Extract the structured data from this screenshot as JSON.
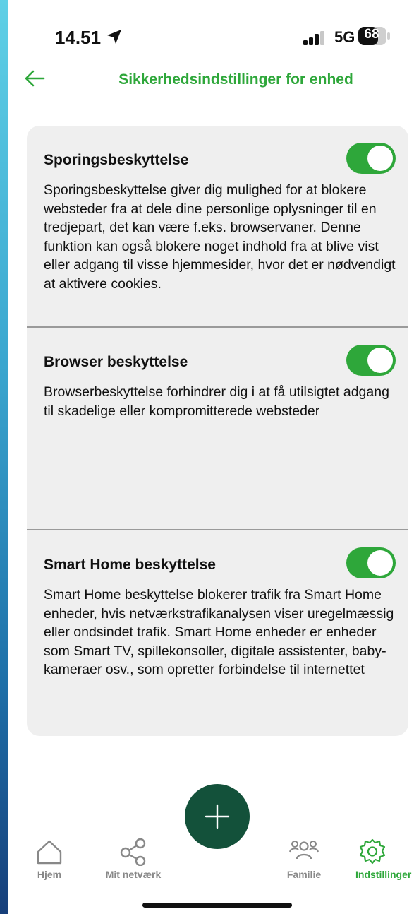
{
  "status_bar": {
    "time": "14.51",
    "network": "5G",
    "battery": "68"
  },
  "header": {
    "title": "Sikkerhedsindstillinger for enhed"
  },
  "settings": [
    {
      "title": "Sporingsbeskyttelse",
      "enabled": true,
      "description": "Sporingsbeskyttelse giver dig mulighed for at blokere websteder fra at dele dine personlige oplysninger til en tredjepart, det kan være f.eks. browservaner. Denne funktion kan også blokere noget indhold fra at blive vist eller adgang til visse hjemmesider, hvor det er nødvendigt at aktivere cookies."
    },
    {
      "title": "Browser beskyttelse",
      "enabled": true,
      "description": "Browserbeskyttelse forhindrer dig i at få utilsigtet adgang til skadelige eller kompromitterede websteder"
    },
    {
      "title": "Smart Home beskyttelse",
      "enabled": true,
      "description": "Smart Home beskyttelse blokerer trafik fra Smart Home enheder, hvis netværkstrafikanalysen viser uregelmæssig eller ondsindet trafik. Smart Home enheder er enheder som Smart TV, spillekonsoller, digitale assistenter, baby-kameraer osv., som opretter forbindelse til internettet"
    }
  ],
  "nav": {
    "items": [
      {
        "label": "Hjem",
        "icon": "home-icon",
        "active": false
      },
      {
        "label": "Mit netværk",
        "icon": "share-network-icon",
        "active": false
      },
      {
        "label": "Familie",
        "icon": "family-icon",
        "active": false
      },
      {
        "label": "Indstillinger",
        "icon": "gear-icon",
        "active": true
      }
    ],
    "fab_icon": "plus-icon"
  },
  "colors": {
    "accent": "#2ea73a",
    "fab": "#13513a",
    "inactive": "#888888"
  }
}
